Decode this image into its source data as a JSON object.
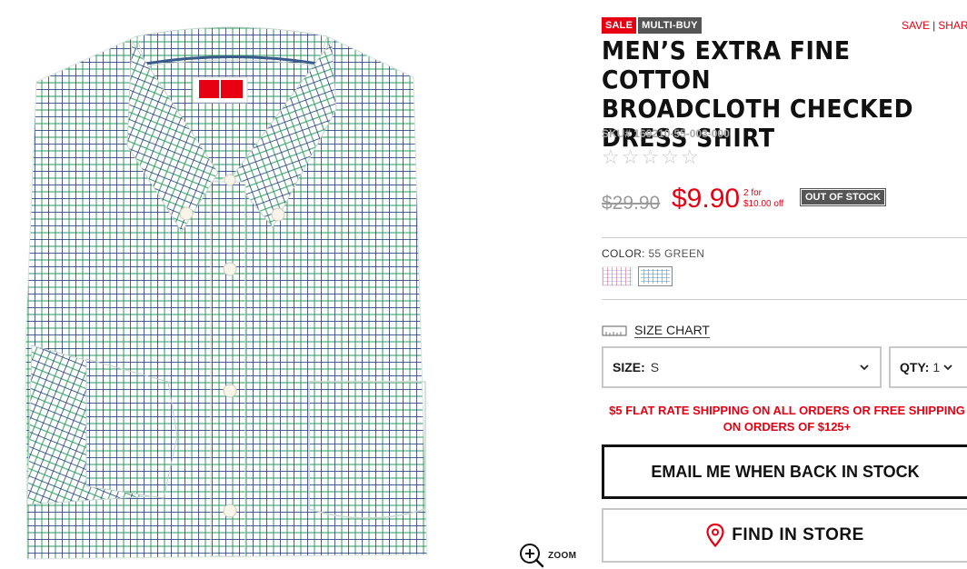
{
  "badges": {
    "sale": "SALE",
    "multibuy": "MULTI-BUY"
  },
  "header_links": {
    "save": "SAVE",
    "separator": "|",
    "share": "SHARE"
  },
  "product": {
    "title_lines": [
      "MEN’S EXTRA FINE COTTON",
      "BROADCLOTH CHECKED",
      "DRESS SHIRT"
    ],
    "sku_label": "SKU#",
    "sku": "169210-55-003-000",
    "rating": 0,
    "rating_max": 5
  },
  "price": {
    "original": "$29.90",
    "sale": "$9.90",
    "multi_line1": "2 for",
    "multi_line2": "$10.00 off",
    "stock_status": "OUT OF STOCK"
  },
  "color": {
    "label": "COLOR:",
    "selected": "55 GREEN",
    "swatches": [
      {
        "name": "red",
        "selected": false
      },
      {
        "name": "green",
        "selected": true
      }
    ]
  },
  "size_chart": {
    "label": "SIZE CHART",
    "icon": "ruler-icon"
  },
  "size_select": {
    "label": "SIZE:",
    "value": "S",
    "icon": "chevron-down-icon"
  },
  "qty_select": {
    "label": "QTY:",
    "value": "1",
    "icon": "chevron-down-icon"
  },
  "shipping": {
    "line1": "$5 FLAT RATE SHIPPING ON ALL ORDERS OR FREE SHIPPING",
    "line2": "ON ORDERS OF $125+"
  },
  "buttons": {
    "email": "EMAIL ME WHEN BACK IN STOCK",
    "store": "FIND IN STORE",
    "store_icon": "map-pin-icon"
  },
  "zoom": {
    "label": "ZOOM",
    "icon": "zoom-in-icon"
  },
  "colors": {
    "accent": "#e60012",
    "badge_gray": "#555555",
    "text": "#1a1a1a"
  }
}
